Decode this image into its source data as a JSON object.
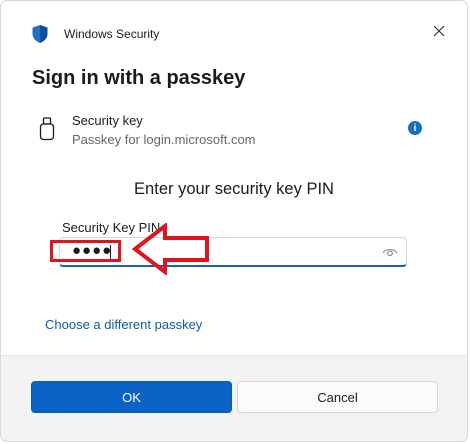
{
  "window": {
    "title": "Windows Security"
  },
  "heading": "Sign in with a passkey",
  "key": {
    "title": "Security key",
    "subtitle": "Passkey for login.microsoft.com",
    "info_glyph": "i"
  },
  "prompt": "Enter your security key PIN",
  "pin": {
    "label": "Security Key PIN",
    "masked_value": "●●●●"
  },
  "link": {
    "different_passkey": "Choose a different passkey"
  },
  "buttons": {
    "ok": "OK",
    "cancel": "Cancel"
  },
  "colors": {
    "accent": "#0a62c4",
    "link": "#0b5cab",
    "annotation": "#e0141e",
    "footer_bg": "#f3f3f3"
  },
  "icons": [
    "shield-icon",
    "close-icon",
    "usb-key-icon",
    "info-icon",
    "eye-icon",
    "arrow-left-icon"
  ]
}
